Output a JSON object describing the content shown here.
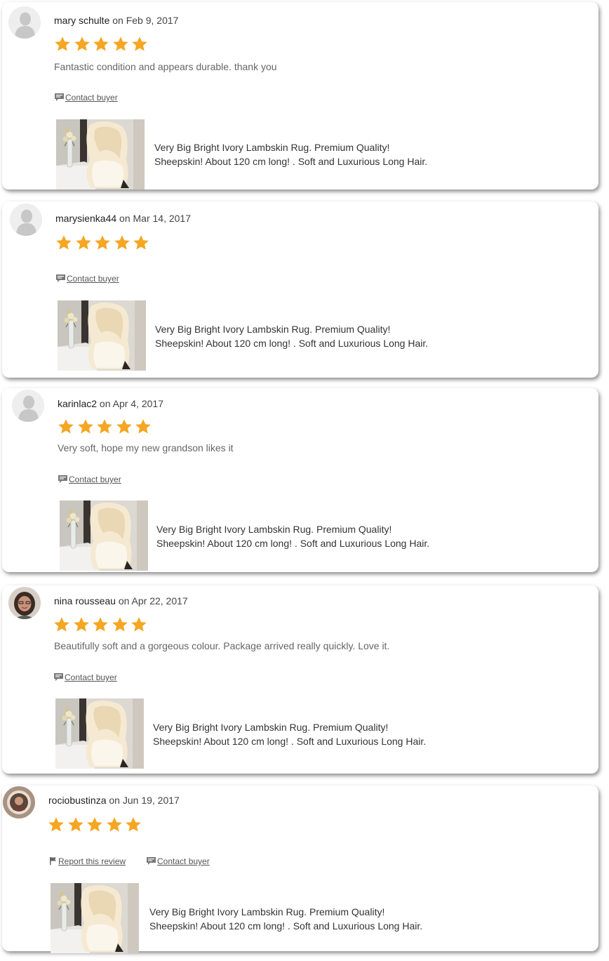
{
  "colors": {
    "star": "#f5a623",
    "link": "#555555",
    "text": "#666666"
  },
  "reviews": [
    {
      "avatar": "default-avatar-icon",
      "username": "mary schulte",
      "date_text": "on Feb 9, 2017",
      "rating": 5,
      "text": "Fantastic condition and appears durable. thank you",
      "links": {
        "contact": "Contact buyer"
      },
      "listing": {
        "line1": "Very Big Bright Ivory Lambskin Rug. Premium Quality!",
        "line2": "Sheepskin! About 120 cm long! . Soft and Luxurious Long Hair."
      }
    },
    {
      "avatar": "default-avatar-icon",
      "username": "marysienka44",
      "date_text": "on Mar 14, 2017",
      "rating": 5,
      "text": "",
      "links": {
        "contact": "Contact buyer"
      },
      "listing": {
        "line1": "Very Big Bright Ivory Lambskin Rug. Premium Quality!",
        "line2": "Sheepskin! About 120 cm long! . Soft and Luxurious Long Hair."
      }
    },
    {
      "avatar": "default-avatar-icon",
      "username": "karinlac2",
      "date_text": "on Apr 4, 2017",
      "rating": 5,
      "text": "Very soft, hope my new grandson likes it",
      "links": {
        "contact": "Contact buyer"
      },
      "listing": {
        "line1": "Very Big Bright Ivory Lambskin Rug. Premium Quality!",
        "line2": "Sheepskin! About 120 cm long! . Soft and Luxurious Long Hair."
      }
    },
    {
      "avatar": "user-photo-avatar",
      "username": "nina rousseau",
      "date_text": "on Apr 22, 2017",
      "rating": 5,
      "text": "Beautifully soft and a gorgeous colour. Package arrived really quickly. Love it.",
      "links": {
        "contact": "Contact buyer"
      },
      "listing": {
        "line1": "Very Big Bright Ivory Lambskin Rug. Premium Quality!",
        "line2": "Sheepskin! About 120 cm long! . Soft and Luxurious Long Hair."
      }
    },
    {
      "avatar": "user-photo-avatar",
      "username": "rociobustinza",
      "date_text": "on Jun 19, 2017",
      "rating": 5,
      "text": "",
      "links": {
        "report": "Report this review",
        "contact": "Contact buyer"
      },
      "listing": {
        "line1": "Very Big Bright Ivory Lambskin Rug. Premium Quality!",
        "line2": "Sheepskin! About 120 cm long! . Soft and Luxurious Long Hair."
      }
    }
  ]
}
